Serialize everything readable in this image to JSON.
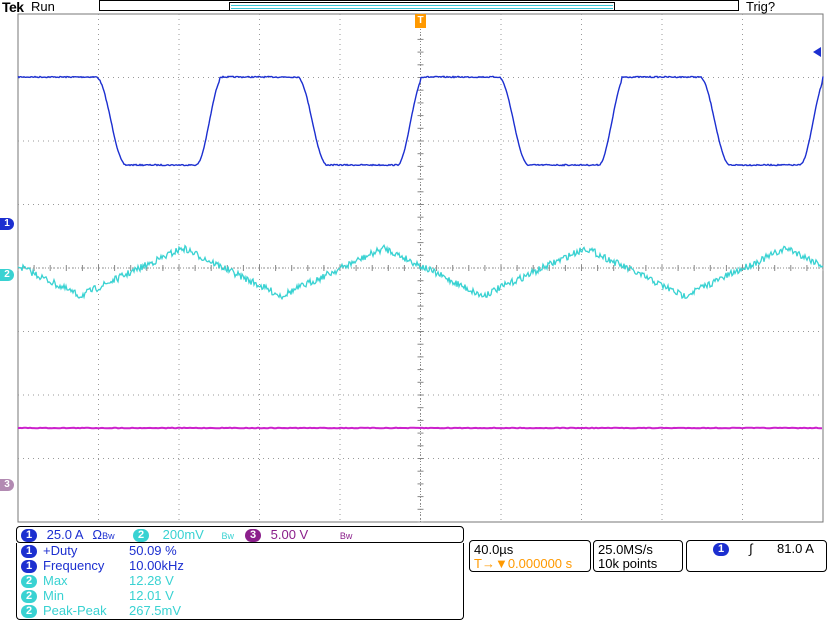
{
  "header": {
    "brand": "Tek",
    "run_state": "Run",
    "trigger_state": "Trig?"
  },
  "colors": {
    "ch1": "#1c2fd0",
    "ch2": "#39d2d2",
    "ch3": "#cc22cc",
    "trigger": "#ff9900",
    "grid": "#888888"
  },
  "markers": {
    "ch1": "1",
    "ch2": "2",
    "ch3": "3",
    "trigger": "T"
  },
  "scales": {
    "ch1": {
      "label": "1",
      "value": "25.0 A",
      "coupling": "Ω",
      "bw": "Bw"
    },
    "ch2": {
      "label": "2",
      "value": "200mV",
      "bw": "Bw"
    },
    "ch3": {
      "label": "3",
      "value": "5.00 V",
      "bw": "Bw"
    }
  },
  "measurements": [
    {
      "source": "1",
      "name": "+Duty",
      "value": "50.09 %"
    },
    {
      "source": "1",
      "name": "Frequency",
      "value": "10.00kHz"
    },
    {
      "source": "2",
      "name": "Max",
      "value": "12.28 V"
    },
    {
      "source": "2",
      "name": "Min",
      "value": "12.01 V"
    },
    {
      "source": "2",
      "name": "Peak-Peak",
      "value": "267.5mV"
    }
  ],
  "timebase": {
    "scale": "40.0µs",
    "trigger_pos_symbol": "T→▼",
    "trigger_position": "0.000000 s"
  },
  "acquisition": {
    "sample_rate": "25.0MS/s",
    "record_length": "10k points"
  },
  "trigger": {
    "source": "1",
    "slope_icon": "rising-edge-icon",
    "slope_symbol": "∫",
    "level": "81.0 A"
  },
  "chart_data": {
    "type": "line",
    "title": "",
    "grid": true,
    "divisions": {
      "x": 10,
      "y": 8
    },
    "series": [
      {
        "channel": "1",
        "shape": "trapezoid square wave",
        "frequency_kHz": 10.0,
        "duty_percent": 50.09
      },
      {
        "channel": "2",
        "shape": "noisy triangle ripple",
        "max_V": 12.28,
        "min_V": 12.01,
        "pk_pk_mV": 267.5
      },
      {
        "channel": "3",
        "shape": "flat DC line"
      }
    ]
  }
}
